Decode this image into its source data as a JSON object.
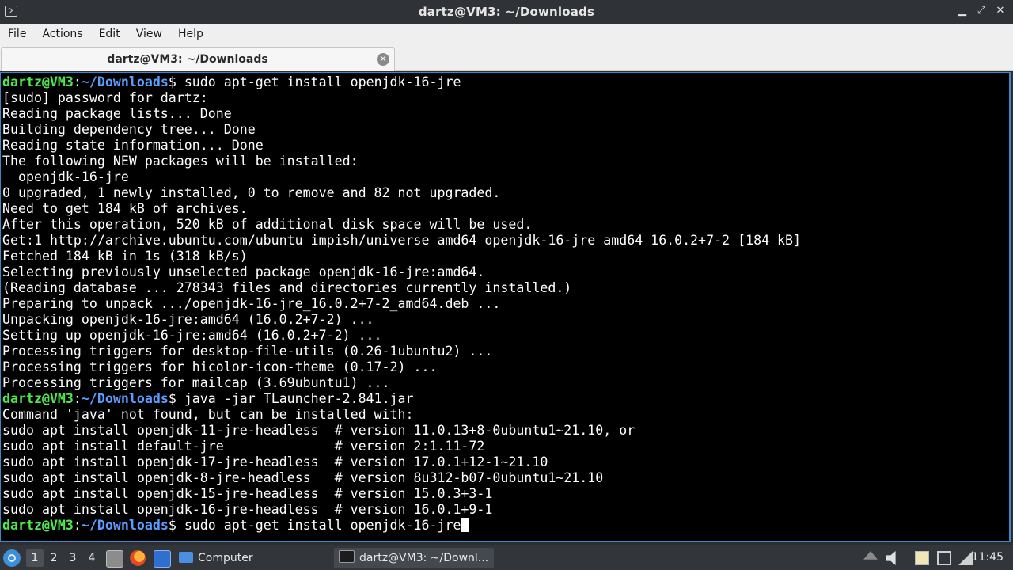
{
  "window": {
    "title": "dartz@VM3: ~/Downloads",
    "controls": {
      "minimize": "▁",
      "maximize": "⤢",
      "close": "✕"
    }
  },
  "menu": [
    "File",
    "Actions",
    "Edit",
    "View",
    "Help"
  ],
  "tab": {
    "label": "dartz@VM3: ~/Downloads",
    "close": "✕"
  },
  "terminal": {
    "prompt_user": "dartz@VM3",
    "prompt_path": "~/Downloads",
    "lines": [
      {
        "prompt": true,
        "cmd": "sudo apt-get install openjdk-16-jre"
      },
      {
        "text": "[sudo] password for dartz:"
      },
      {
        "text": "Reading package lists... Done"
      },
      {
        "text": "Building dependency tree... Done"
      },
      {
        "text": "Reading state information... Done"
      },
      {
        "text": "The following NEW packages will be installed:"
      },
      {
        "text": "  openjdk-16-jre"
      },
      {
        "text": "0 upgraded, 1 newly installed, 0 to remove and 82 not upgraded."
      },
      {
        "text": "Need to get 184 kB of archives."
      },
      {
        "text": "After this operation, 520 kB of additional disk space will be used."
      },
      {
        "text": "Get:1 http://archive.ubuntu.com/ubuntu impish/universe amd64 openjdk-16-jre amd64 16.0.2+7-2 [184 kB]"
      },
      {
        "text": "Fetched 184 kB in 1s (318 kB/s)"
      },
      {
        "text": "Selecting previously unselected package openjdk-16-jre:amd64."
      },
      {
        "text": "(Reading database ... 278343 files and directories currently installed.)"
      },
      {
        "text": "Preparing to unpack .../openjdk-16-jre_16.0.2+7-2_amd64.deb ..."
      },
      {
        "text": "Unpacking openjdk-16-jre:amd64 (16.0.2+7-2) ..."
      },
      {
        "text": "Setting up openjdk-16-jre:amd64 (16.0.2+7-2) ..."
      },
      {
        "text": "Processing triggers for desktop-file-utils (0.26-1ubuntu2) ..."
      },
      {
        "text": "Processing triggers for hicolor-icon-theme (0.17-2) ..."
      },
      {
        "text": "Processing triggers for mailcap (3.69ubuntu1) ..."
      },
      {
        "prompt": true,
        "cmd": "java -jar TLauncher-2.841.jar"
      },
      {
        "text": "Command 'java' not found, but can be installed with:"
      },
      {
        "text": "sudo apt install openjdk-11-jre-headless  # version 11.0.13+8-0ubuntu1~21.10, or"
      },
      {
        "text": "sudo apt install default-jre              # version 2:1.11-72"
      },
      {
        "text": "sudo apt install openjdk-17-jre-headless  # version 17.0.1+12-1~21.10"
      },
      {
        "text": "sudo apt install openjdk-8-jre-headless   # version 8u312-b07-0ubuntu1~21.10"
      },
      {
        "text": "sudo apt install openjdk-15-jre-headless  # version 15.0.3+3-1"
      },
      {
        "text": "sudo apt install openjdk-16-jre-headless  # version 16.0.1+9-1"
      },
      {
        "prompt": true,
        "cmd": "sudo apt-get install openjdk-16-jre",
        "cursor": true
      }
    ]
  },
  "taskbar": {
    "workspaces": [
      "1",
      "2",
      "3",
      "4"
    ],
    "active_workspace": "1",
    "launchers": [
      "file-manager-icon",
      "firefox-icon",
      "desktop-icon"
    ],
    "tasks": [
      {
        "label": "Computer",
        "icon": "folder-icon",
        "active": false
      },
      {
        "label": "dartz@VM3: ~/Downl...",
        "icon": "terminal-icon",
        "active": true
      }
    ],
    "tray": [
      "eject-icon",
      "volume-icon",
      "clipboard-icon",
      "display-icon",
      "network-icon"
    ],
    "clock": "11:45"
  },
  "colors": {
    "prompt_user": "#4fe64f",
    "prompt_path": "#5c9cff",
    "terminal_bg": "#000000",
    "accent": "#3a87c9"
  }
}
